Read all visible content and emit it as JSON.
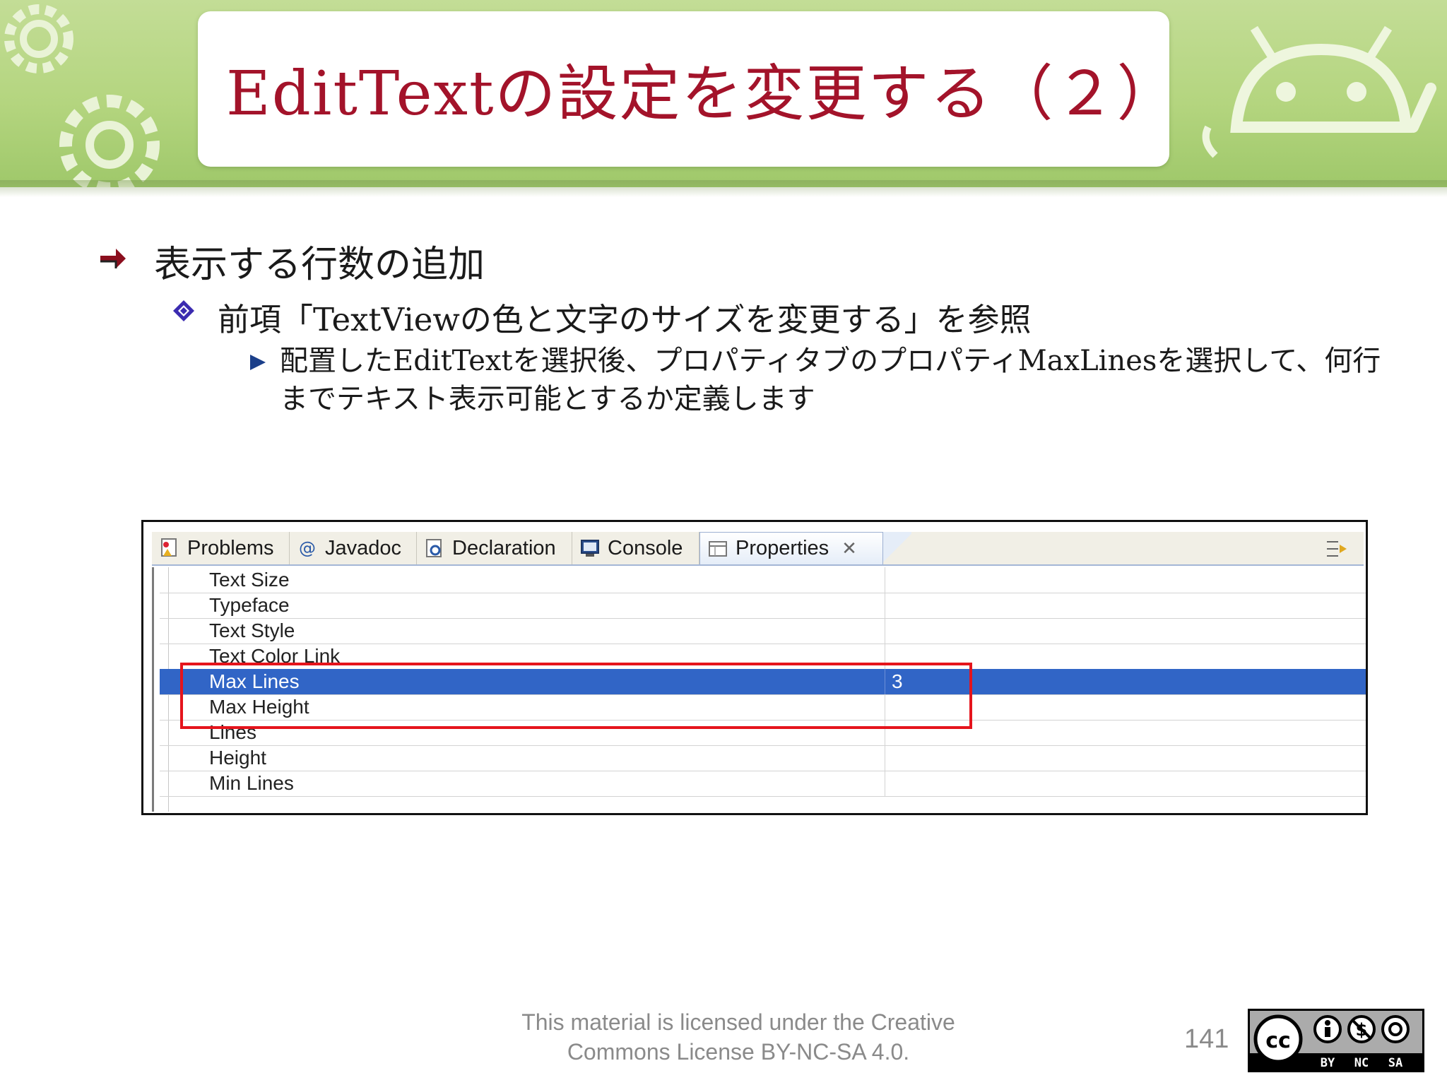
{
  "slide": {
    "title": "EditTextの設定を変更する（２）",
    "bullet1": "表示する行数の追加",
    "bullet2": "前項「TextViewの色と文字のサイズを変更する」を参照",
    "bullet3": "配置したEditTextを選択後、プロパティタブのプロパティMaxLinesを選択して、何行までテキスト表示可能とするか定義します"
  },
  "panel": {
    "tabs": [
      {
        "label": "Problems",
        "icon": "problems-icon"
      },
      {
        "label": "Javadoc",
        "icon": "at-icon"
      },
      {
        "label": "Declaration",
        "icon": "declaration-icon"
      },
      {
        "label": "Console",
        "icon": "console-icon"
      },
      {
        "label": "Properties",
        "icon": "properties-icon",
        "active": true
      }
    ],
    "close_glyph": "✕",
    "rows": [
      {
        "name": "Text Size",
        "value": ""
      },
      {
        "name": "Typeface",
        "value": ""
      },
      {
        "name": "Text Style",
        "value": ""
      },
      {
        "name": "Text Color Link",
        "value": ""
      },
      {
        "name": "Max Lines",
        "value": "3",
        "selected": true
      },
      {
        "name": "Max Height",
        "value": ""
      },
      {
        "name": "Lines",
        "value": ""
      },
      {
        "name": "Height",
        "value": ""
      },
      {
        "name": "Min Lines",
        "value": ""
      }
    ],
    "selection_color": "#3165c6",
    "highlight_color": "#e5141c"
  },
  "footer": {
    "license_line1": "This material is licensed under the Creative",
    "license_line2": "Commons License BY-NC-SA 4.0.",
    "page_number": "141",
    "cc_badge": {
      "by": "BY",
      "nc": "NC",
      "sa": "SA",
      "cc": "cc"
    }
  },
  "colors": {
    "title": "#a3132a",
    "banner": "#b4d57f",
    "bullet_arrow": "#8b0e1e",
    "bullet_diamond": "#3b2bb0",
    "bullet_triangle": "#1b3f8a"
  }
}
